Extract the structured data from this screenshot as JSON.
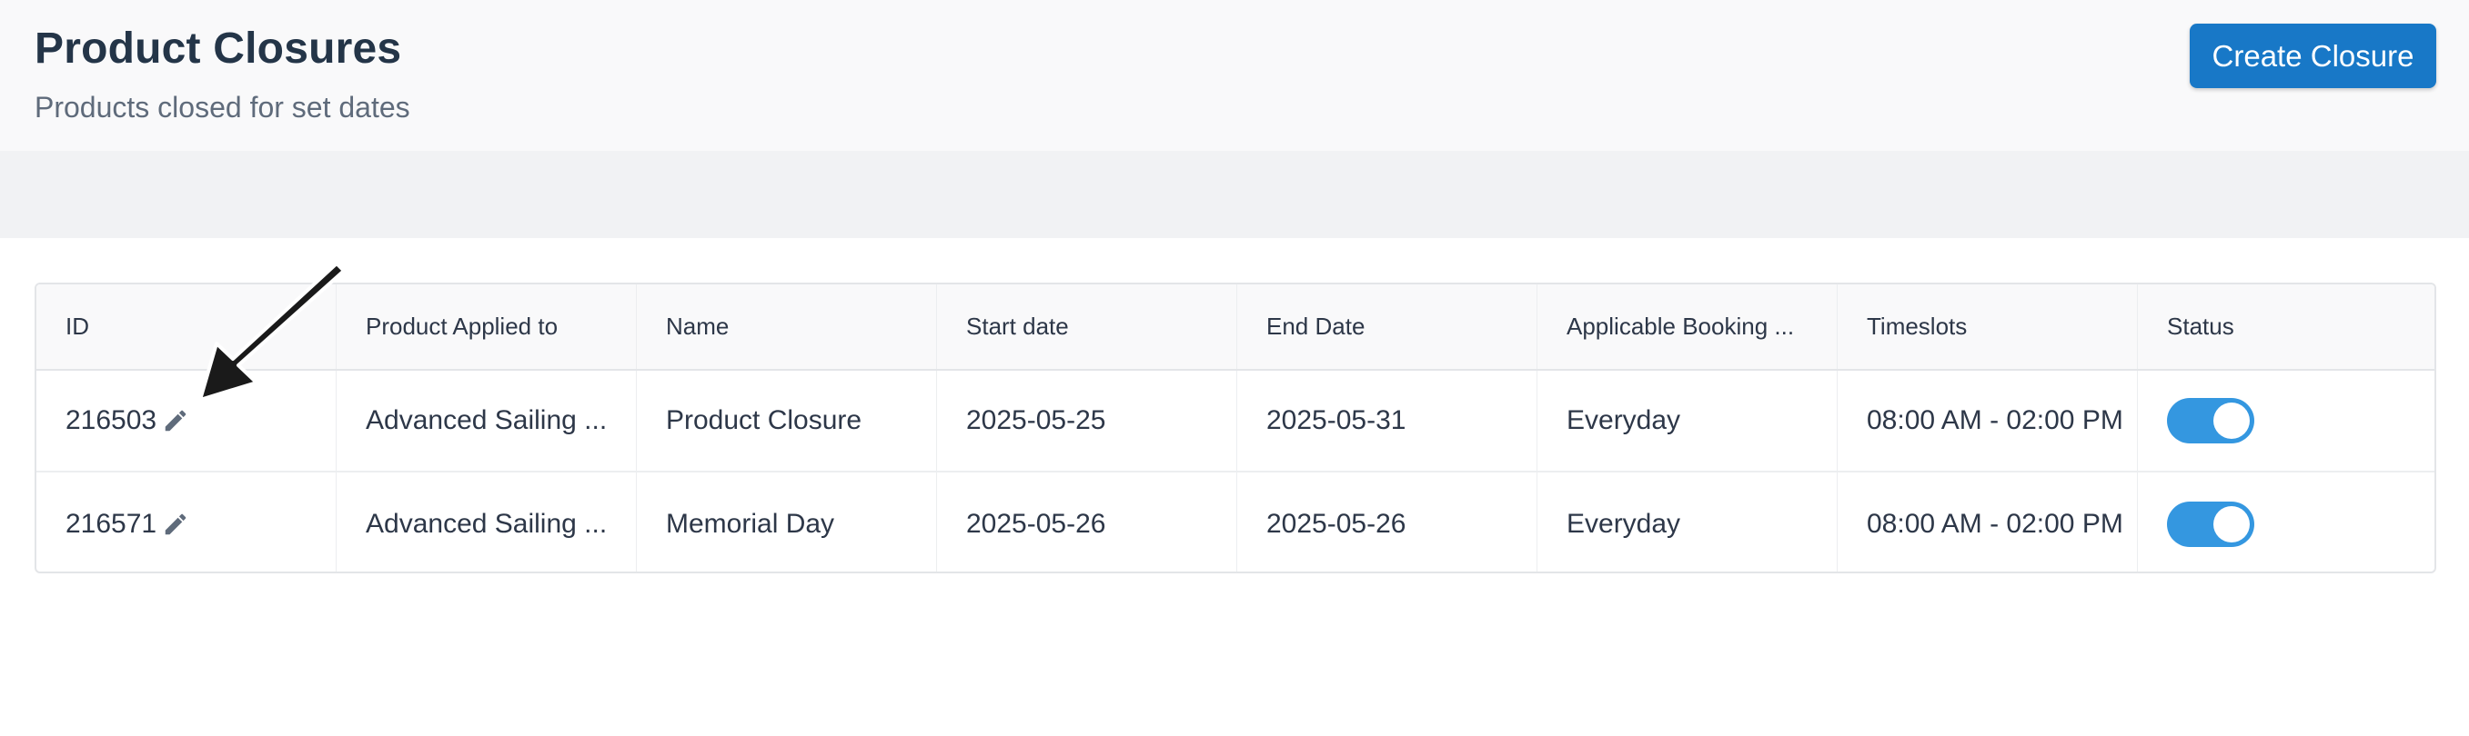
{
  "header": {
    "title": "Product Closures",
    "subtitle": "Products closed for set dates",
    "create_button_label": "Create Closure"
  },
  "table": {
    "columns": [
      "ID",
      "Product Applied to",
      "Name",
      "Start date",
      "End Date",
      "Applicable Booking ...",
      "Timeslots",
      "Status"
    ],
    "rows": [
      {
        "id": "216503",
        "product": "Advanced Sailing ...",
        "name": "Product Closure",
        "start_date": "2025-05-25",
        "end_date": "2025-05-31",
        "booking": "Everyday",
        "timeslots": "08:00 AM - 02:00 PM",
        "status_on": true
      },
      {
        "id": "216571",
        "product": "Advanced Sailing ...",
        "name": "Memorial Day",
        "start_date": "2025-05-26",
        "end_date": "2025-05-26",
        "booking": "Everyday",
        "timeslots": "08:00 AM - 02:00 PM",
        "status_on": true
      }
    ]
  },
  "icons": {
    "edit": "pencil-icon",
    "annotation": "arrow-pointer"
  },
  "colors": {
    "primary_button": "#1878c7",
    "toggle_on": "#3497e0",
    "title": "#243548"
  }
}
